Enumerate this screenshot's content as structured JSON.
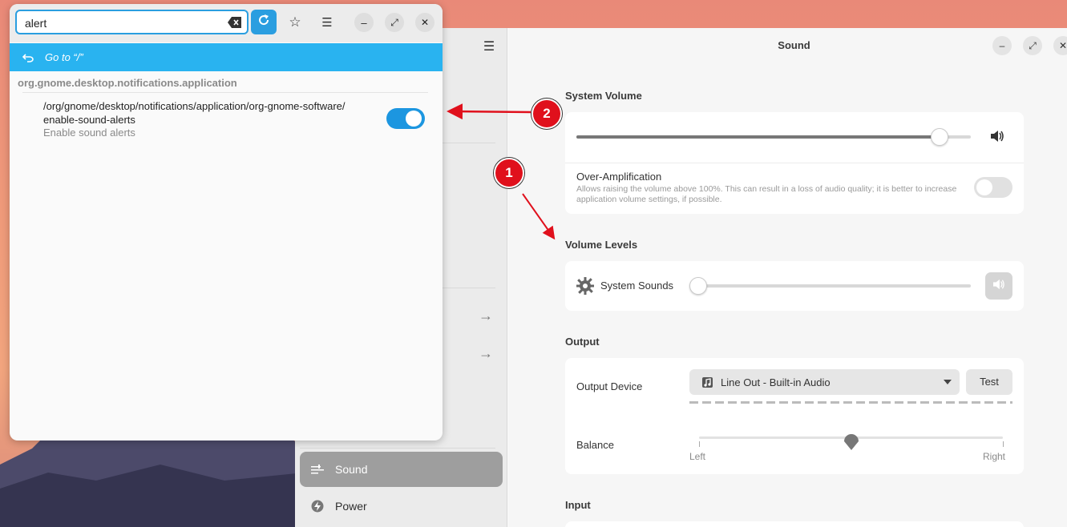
{
  "settings": {
    "title": "Sound",
    "sidebar": {
      "items": [
        {
          "label": "Sound",
          "icon": "sound-icon",
          "active": true
        },
        {
          "label": "Power",
          "icon": "power-icon",
          "active": false
        }
      ]
    },
    "system_volume": {
      "title": "System Volume",
      "level": 0.92,
      "over_amplification": {
        "label": "Over-Amplification",
        "description": "Allows raising the volume above 100%. This can result in a loss of audio quality; it is better to increase application volume settings, if possible.",
        "enabled": false
      }
    },
    "volume_levels": {
      "title": "Volume Levels",
      "system_sounds": {
        "label": "System Sounds",
        "level": 0.0
      }
    },
    "output": {
      "title": "Output",
      "device_label": "Output Device",
      "device_value": "Line Out - Built-in Audio",
      "test_label": "Test",
      "balance_label": "Balance",
      "balance_left": "Left",
      "balance_right": "Right",
      "balance_value": 0.5
    },
    "input": {
      "title": "Input"
    }
  },
  "dconf": {
    "search_value": "alert",
    "goto_label": "Go to “/”",
    "schema": "org.gnome.desktop.notifications.application",
    "key_path": "/org/gnome/desktop/notifications/application/org-gnome-software/enable-sound-alerts",
    "key_path_line1": "/org/gnome/desktop/notifications/application/org-gnome-software/",
    "key_path_line2": "enable-sound-alerts",
    "key_description": "Enable sound alerts",
    "key_enabled": true
  },
  "annotations": {
    "badge_1": "1",
    "badge_2": "2",
    "color": "#e0101c"
  },
  "colors": {
    "accent": "#2a9ee0",
    "goto_bar": "#29b3f0",
    "toggle_on": "#1c96e0"
  }
}
